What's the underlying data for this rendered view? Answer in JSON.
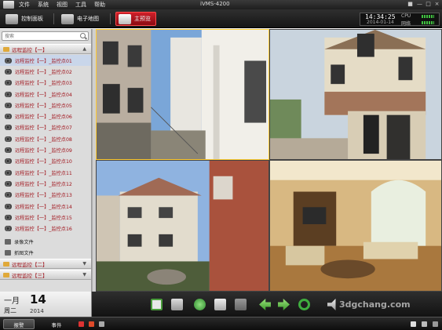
{
  "app": {
    "window_title": "iVMS-4200",
    "menu": [
      "文件",
      "系统",
      "视图",
      "工具",
      "帮助"
    ],
    "window_controls": [
      "lock-icon",
      "minimize-icon",
      "maximize-icon",
      "close-icon"
    ]
  },
  "toolbar": {
    "tabs": [
      {
        "label": "控制面板",
        "icon": "control-panel-icon",
        "active": false
      },
      {
        "label": "电子地图",
        "icon": "emap-icon",
        "active": false
      },
      {
        "label": "主预览",
        "icon": "main-preview-icon",
        "active": true
      }
    ]
  },
  "status_clock": {
    "time": "14:34:25",
    "date": "2014-01-14",
    "cpu_label": "CPU",
    "network_label": "网络"
  },
  "sidebar": {
    "search_placeholder": "搜索",
    "group1": "远程监控【一】",
    "cameras": [
      "远程监控【一】_监控点01",
      "远程监控【一】_监控点02",
      "远程监控【一】_监控点03",
      "远程监控【一】_监控点04",
      "远程监控【一】_监控点05",
      "远程监控【一】_监控点06",
      "远程监控【一】_监控点07",
      "远程监控【一】_监控点08",
      "远程监控【一】_监控点09",
      "远程监控【一】_监控点10",
      "远程监控【一】_监控点11",
      "远程监控【一】_监控点12",
      "远程监控【一】_监控点13",
      "远程监控【一】_监控点14",
      "远程监控【一】_监控点15",
      "远程监控【一】_监控点16"
    ],
    "recording_files": "录像文件",
    "snapshot_files": "抓图文件",
    "group2": "远程监控【二】",
    "group3": "远程监控【三】"
  },
  "date_panel": {
    "month": "一月",
    "day": "14",
    "weekday": "周二",
    "year": "2014"
  },
  "controls": [
    "fullscreen-icon",
    "layout-icon",
    "play-icon",
    "snapshot-icon",
    "record-icon",
    "ptz-left-icon",
    "ptz-right-icon",
    "refresh-icon",
    "volume-icon"
  ],
  "status_bar": {
    "tabs": [
      {
        "label": "报警",
        "active": true
      },
      {
        "label": "事件",
        "active": false
      }
    ]
  },
  "watermark": "3dgchang.com"
}
